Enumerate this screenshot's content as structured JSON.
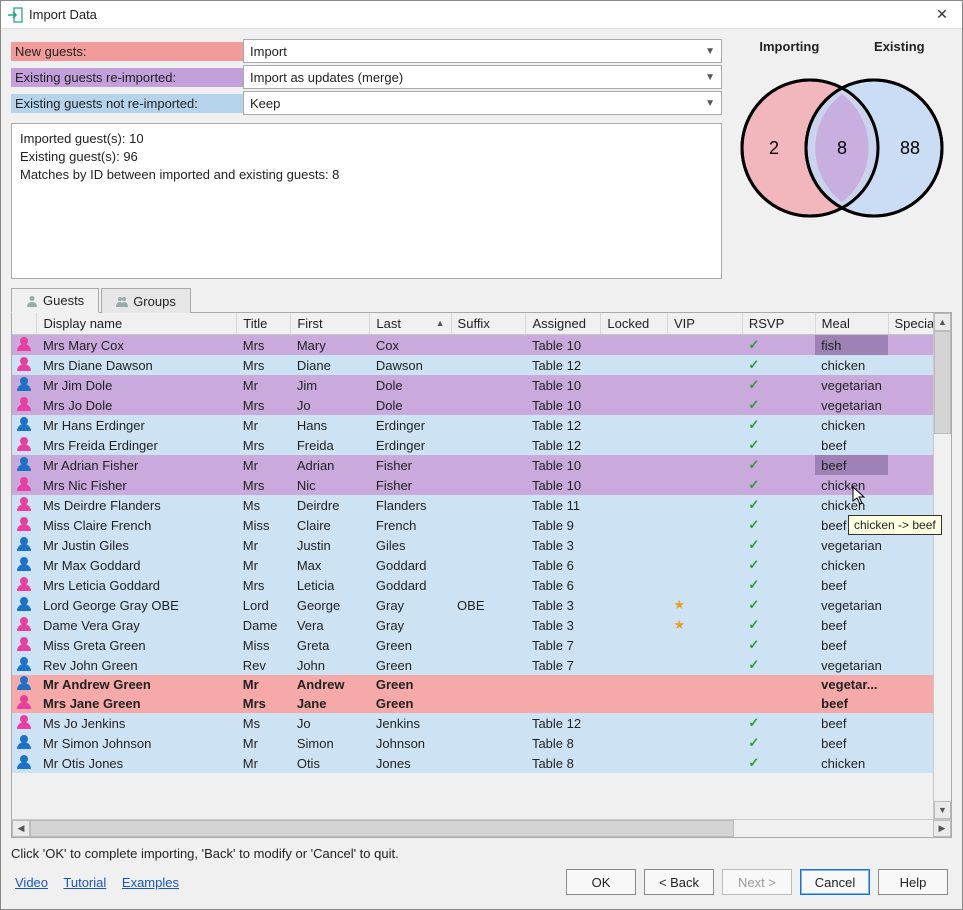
{
  "window": {
    "title": "Import Data"
  },
  "config": {
    "new_label": "New guests:",
    "new_value": "Import",
    "reimport_label": "Existing guests re-imported:",
    "reimport_value": "Import as updates (merge)",
    "notre_label": "Existing guests not re-imported:",
    "notre_value": "Keep"
  },
  "summary": {
    "line1": "Imported guest(s): 10",
    "line2": "Existing guest(s): 96",
    "line3": "Matches by ID between imported and existing guests: 8"
  },
  "venn": {
    "left_label": "Importing",
    "right_label": "Existing",
    "left_only": "2",
    "overlap": "8",
    "right_only": "88"
  },
  "tabs": {
    "guests": "Guests",
    "groups": "Groups"
  },
  "columns": {
    "display": "Display name",
    "title": "Title",
    "first": "First",
    "last": "Last",
    "suffix": "Suffix",
    "assigned": "Assigned",
    "locked": "Locked",
    "vip": "VIP",
    "rsvp": "RSVP",
    "meal": "Meal",
    "special": "Special"
  },
  "rows": [
    {
      "cls": "purple",
      "g": "pink",
      "display": "Mrs Mary Cox",
      "title": "Mrs",
      "first": "Mary",
      "last": "Cox",
      "suffix": "",
      "assigned": "Table 10",
      "vip": "",
      "rsvp": "✓",
      "meal": "fish",
      "meal_hl": true
    },
    {
      "cls": "blue",
      "g": "pink",
      "display": "Mrs Diane Dawson",
      "title": "Mrs",
      "first": "Diane",
      "last": "Dawson",
      "suffix": "",
      "assigned": "Table 12",
      "vip": "",
      "rsvp": "✓",
      "meal": "chicken"
    },
    {
      "cls": "purple",
      "g": "blue",
      "display": "Mr Jim Dole",
      "title": "Mr",
      "first": "Jim",
      "last": "Dole",
      "suffix": "",
      "assigned": "Table 10",
      "vip": "",
      "rsvp": "✓",
      "meal": "vegetarian"
    },
    {
      "cls": "purple",
      "g": "pink",
      "display": "Mrs Jo Dole",
      "title": "Mrs",
      "first": "Jo",
      "last": "Dole",
      "suffix": "",
      "assigned": "Table 10",
      "vip": "",
      "rsvp": "✓",
      "meal": "vegetarian"
    },
    {
      "cls": "blue",
      "g": "blue",
      "display": "Mr Hans Erdinger",
      "title": "Mr",
      "first": "Hans",
      "last": "Erdinger",
      "suffix": "",
      "assigned": "Table 12",
      "vip": "",
      "rsvp": "✓",
      "meal": "chicken"
    },
    {
      "cls": "blue",
      "g": "pink",
      "display": "Mrs Freida Erdinger",
      "title": "Mrs",
      "first": "Freida",
      "last": "Erdinger",
      "suffix": "",
      "assigned": "Table 12",
      "vip": "",
      "rsvp": "✓",
      "meal": "beef"
    },
    {
      "cls": "purple",
      "g": "blue",
      "display": "Mr Adrian Fisher",
      "title": "Mr",
      "first": "Adrian",
      "last": "Fisher",
      "suffix": "",
      "assigned": "Table 10",
      "vip": "",
      "rsvp": "✓",
      "meal": "beef",
      "meal_hl": true
    },
    {
      "cls": "purple",
      "g": "pink",
      "display": "Mrs Nic Fisher",
      "title": "Mrs",
      "first": "Nic",
      "last": "Fisher",
      "suffix": "",
      "assigned": "Table 10",
      "vip": "",
      "rsvp": "✓",
      "meal": "chicken"
    },
    {
      "cls": "blue",
      "g": "pink",
      "display": "Ms Deirdre Flanders",
      "title": "Ms",
      "first": "Deirdre",
      "last": "Flanders",
      "suffix": "",
      "assigned": "Table 11",
      "vip": "",
      "rsvp": "✓",
      "meal": "chicken"
    },
    {
      "cls": "blue",
      "g": "pink",
      "display": "Miss Claire French",
      "title": "Miss",
      "first": "Claire",
      "last": "French",
      "suffix": "",
      "assigned": "Table 9",
      "vip": "",
      "rsvp": "✓",
      "meal": "beef"
    },
    {
      "cls": "blue",
      "g": "blue",
      "display": "Mr Justin Giles",
      "title": "Mr",
      "first": "Justin",
      "last": "Giles",
      "suffix": "",
      "assigned": "Table 3",
      "vip": "",
      "rsvp": "✓",
      "meal": "vegetarian"
    },
    {
      "cls": "blue",
      "g": "blue",
      "display": "Mr Max Goddard",
      "title": "Mr",
      "first": "Max",
      "last": "Goddard",
      "suffix": "",
      "assigned": "Table 6",
      "vip": "",
      "rsvp": "✓",
      "meal": "chicken"
    },
    {
      "cls": "blue",
      "g": "pink",
      "display": "Mrs Leticia Goddard",
      "title": "Mrs",
      "first": "Leticia",
      "last": "Goddard",
      "suffix": "",
      "assigned": "Table 6",
      "vip": "",
      "rsvp": "✓",
      "meal": "beef"
    },
    {
      "cls": "blue",
      "g": "blue",
      "display": "Lord George Gray OBE",
      "title": "Lord",
      "first": "George",
      "last": "Gray",
      "suffix": "OBE",
      "assigned": "Table 3",
      "vip": "★",
      "rsvp": "✓",
      "meal": "vegetarian"
    },
    {
      "cls": "blue",
      "g": "pink",
      "display": "Dame Vera Gray",
      "title": "Dame",
      "first": "Vera",
      "last": "Gray",
      "suffix": "",
      "assigned": "Table 3",
      "vip": "★",
      "rsvp": "✓",
      "meal": "beef"
    },
    {
      "cls": "blue",
      "g": "pink",
      "display": "Miss Greta Green",
      "title": "Miss",
      "first": "Greta",
      "last": "Green",
      "suffix": "",
      "assigned": "Table 7",
      "vip": "",
      "rsvp": "✓",
      "meal": "beef"
    },
    {
      "cls": "blue",
      "g": "blue",
      "display": "Rev John Green",
      "title": "Rev",
      "first": "John",
      "last": "Green",
      "suffix": "",
      "assigned": "Table 7",
      "vip": "",
      "rsvp": "✓",
      "meal": "vegetarian"
    },
    {
      "cls": "pink",
      "g": "blue",
      "display": "Mr Andrew Green",
      "title": "Mr",
      "first": "Andrew",
      "last": "Green",
      "suffix": "",
      "assigned": "",
      "vip": "",
      "rsvp": "",
      "meal": "vegetar..."
    },
    {
      "cls": "pink",
      "g": "pink",
      "display": "Mrs Jane Green",
      "title": "Mrs",
      "first": "Jane",
      "last": "Green",
      "suffix": "",
      "assigned": "",
      "vip": "",
      "rsvp": "",
      "meal": "beef"
    },
    {
      "cls": "blue",
      "g": "pink",
      "display": "Ms Jo Jenkins",
      "title": "Ms",
      "first": "Jo",
      "last": "Jenkins",
      "suffix": "",
      "assigned": "Table 12",
      "vip": "",
      "rsvp": "✓",
      "meal": "beef"
    },
    {
      "cls": "blue",
      "g": "blue",
      "display": "Mr Simon Johnson",
      "title": "Mr",
      "first": "Simon",
      "last": "Johnson",
      "suffix": "",
      "assigned": "Table 8",
      "vip": "",
      "rsvp": "✓",
      "meal": "beef"
    },
    {
      "cls": "blue",
      "g": "blue",
      "display": "Mr Otis Jones",
      "title": "Mr",
      "first": "Otis",
      "last": "Jones",
      "suffix": "",
      "assigned": "Table 8",
      "vip": "",
      "rsvp": "✓",
      "meal": "chicken"
    }
  ],
  "tooltip": "chicken -> beef",
  "instruction": "Click 'OK' to complete importing, 'Back' to modify or 'Cancel' to quit.",
  "links": {
    "video": "Video",
    "tutorial": "Tutorial",
    "examples": "Examples"
  },
  "buttons": {
    "ok": "OK",
    "back": "< Back",
    "next": "Next >",
    "cancel": "Cancel",
    "help": "Help"
  }
}
